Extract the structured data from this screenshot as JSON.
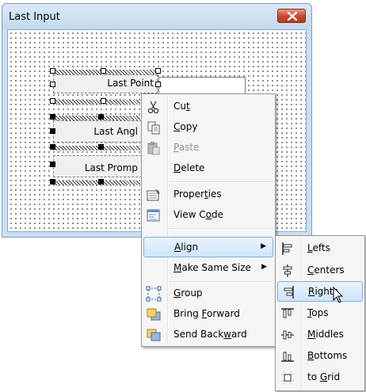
{
  "window": {
    "title": "Last Input"
  },
  "form_controls": {
    "labels": [
      "Last Point",
      "Last Angl",
      "Last Promp"
    ]
  },
  "context_menu": {
    "items": [
      {
        "label": "Cut",
        "accel_index": 2,
        "icon": "scissors-icon",
        "disabled": false
      },
      {
        "label": "Copy",
        "accel_index": 0,
        "icon": "copy-icon",
        "disabled": false
      },
      {
        "label": "Paste",
        "accel_index": 0,
        "icon": "paste-icon",
        "disabled": true
      },
      {
        "label": "Delete",
        "accel_index": 0,
        "icon": "",
        "disabled": false
      },
      {
        "label": "Properties",
        "accel_index": 6,
        "icon": "properties-icon",
        "disabled": false
      },
      {
        "label": "View Code",
        "accel_index": 6,
        "icon": "view-code-icon",
        "disabled": false
      },
      {
        "label": "Align",
        "accel_index": 0,
        "icon": "",
        "disabled": false,
        "submenu": true,
        "highlighted": true
      },
      {
        "label": "Make Same Size",
        "accel_index": 0,
        "icon": "",
        "disabled": false,
        "submenu": true
      },
      {
        "label": "Group",
        "accel_index": 0,
        "icon": "group-icon",
        "disabled": false
      },
      {
        "label": "Bring Forward",
        "accel_index": 6,
        "icon": "bring-forward-icon",
        "disabled": false
      },
      {
        "label": "Send Backward",
        "accel_index": 9,
        "icon": "send-backward-icon",
        "disabled": false
      }
    ]
  },
  "align_submenu": {
    "items": [
      {
        "label": "Lefts",
        "accel_index": 0,
        "icon": "align-lefts-icon"
      },
      {
        "label": "Centers",
        "accel_index": 0,
        "icon": "align-centers-icon"
      },
      {
        "label": "Rights",
        "accel_index": 0,
        "icon": "align-rights-icon",
        "highlighted": true
      },
      {
        "label": "Tops",
        "accel_index": 0,
        "icon": "align-tops-icon"
      },
      {
        "label": "Middles",
        "accel_index": 0,
        "icon": "align-middles-icon"
      },
      {
        "label": "Bottoms",
        "accel_index": 0,
        "icon": "align-bottoms-icon"
      },
      {
        "label": "to Grid",
        "accel_index": 3,
        "icon": "align-to-grid-icon"
      }
    ]
  },
  "colors": {
    "menu_highlight_border": "#84acdd",
    "close_button": "#c7442a"
  }
}
